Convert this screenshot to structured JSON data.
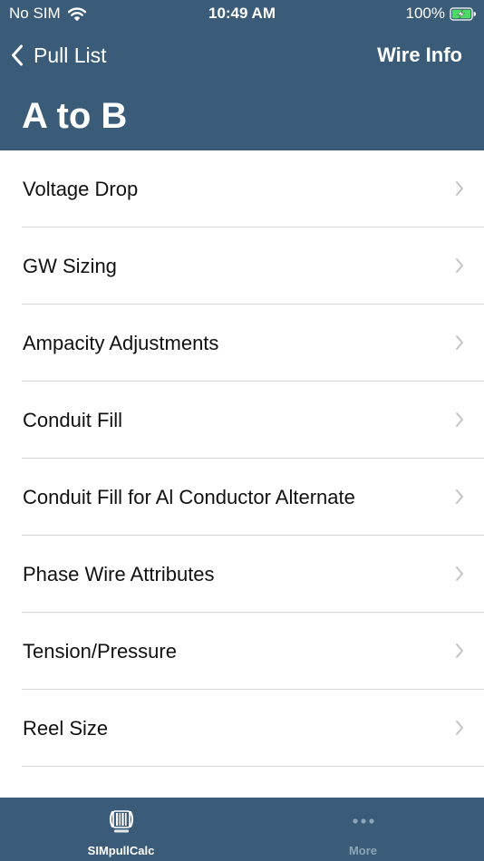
{
  "status_bar": {
    "carrier": "No SIM",
    "time": "10:49 AM",
    "battery_percent": "100%",
    "wifi_icon": "wifi-icon",
    "battery_icon": "battery-charging-icon"
  },
  "nav": {
    "back_label": "Pull List",
    "back_icon": "chevron-left-icon",
    "right_button_label": "Wire Info",
    "title": "A to B"
  },
  "menu": {
    "items": [
      {
        "label": "Voltage Drop"
      },
      {
        "label": "GW Sizing"
      },
      {
        "label": "Ampacity Adjustments"
      },
      {
        "label": "Conduit Fill"
      },
      {
        "label": "Conduit Fill for Al Conductor Alternate"
      },
      {
        "label": "Phase Wire Attributes"
      },
      {
        "label": "Tension/Pressure"
      },
      {
        "label": "Reel Size"
      }
    ],
    "item_icon": "chevron-right-icon"
  },
  "tab_bar": {
    "tabs": [
      {
        "label": "SIMpullCalc",
        "icon": "wire-reel-icon",
        "selected": true
      },
      {
        "label": "More",
        "icon": "ellipsis-icon",
        "selected": false
      }
    ]
  },
  "colors": {
    "header_bg": "#3b5c78",
    "chevron": "#c4c4c7",
    "separator": "#d6d6d9",
    "battery_fill": "#4cd964"
  }
}
